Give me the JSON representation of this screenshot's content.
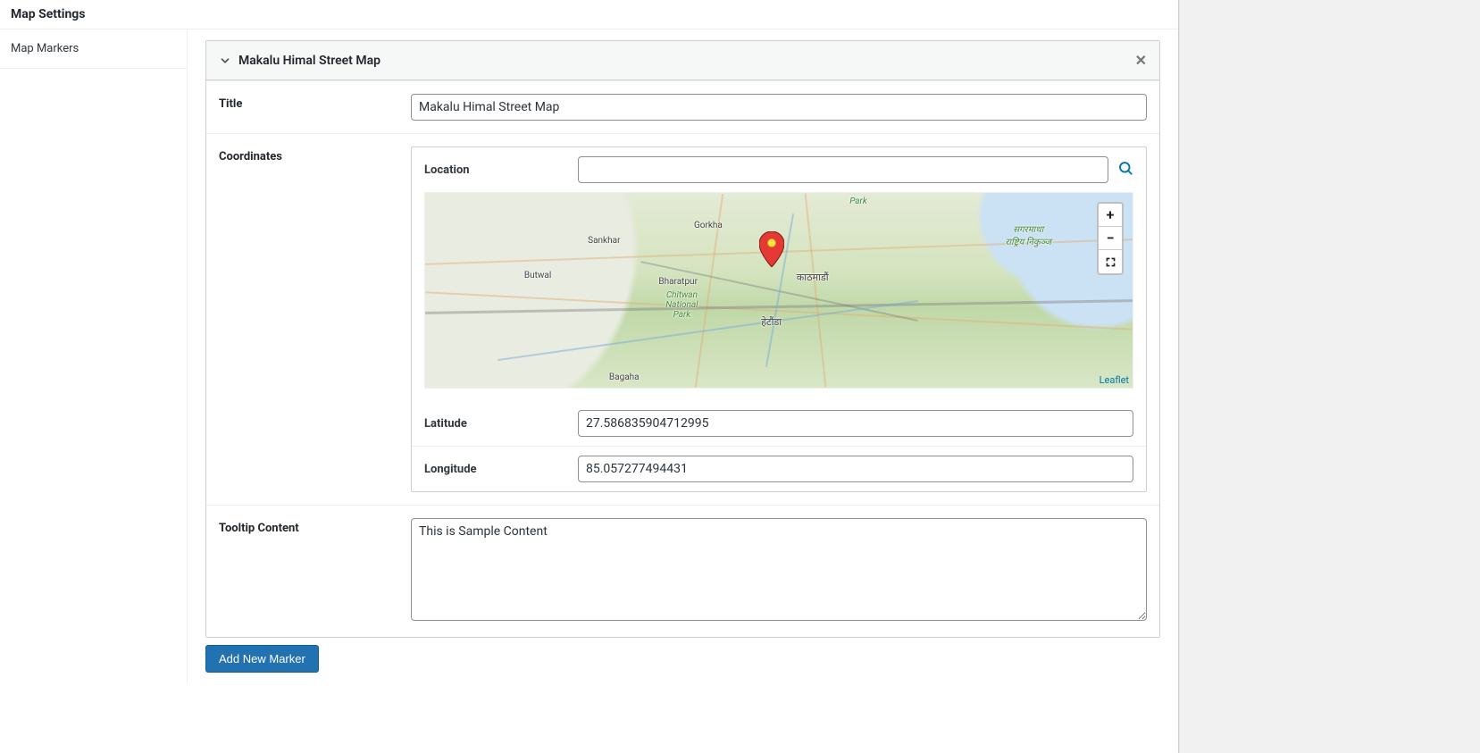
{
  "page": {
    "title": "Map Settings"
  },
  "tabs": {
    "active": "Map Markers"
  },
  "accordion": {
    "title": "Makalu Himal Street Map"
  },
  "fields": {
    "title_label": "Title",
    "title_value": "Makalu Himal Street Map",
    "coordinates_label": "Coordinates",
    "location_label": "Location",
    "location_value": "",
    "latitude_label": "Latitude",
    "latitude_value": "27.586835904712995",
    "longitude_label": "Longitude",
    "longitude_value": "85.057277494431",
    "tooltip_label": "Tooltip Content",
    "tooltip_value": "This is Sample Content"
  },
  "map": {
    "attribution": "Leaflet",
    "labels": {
      "park_top": "Park",
      "gorkha": "Gorkha",
      "sankhar": "Sankhar",
      "kathmandu": "काठमाडौं",
      "sagarmatha": "सगरमाथा\nराष्ट्रिय निकुञ्ज",
      "butwal": "Butwal",
      "bharatpur": "Bharatpur",
      "chitwan": "Chitwan\nNational\nPark",
      "hetauda": "हेटौंडा",
      "bagaha": "Bagaha"
    }
  },
  "actions": {
    "add_marker": "Add New Marker"
  }
}
